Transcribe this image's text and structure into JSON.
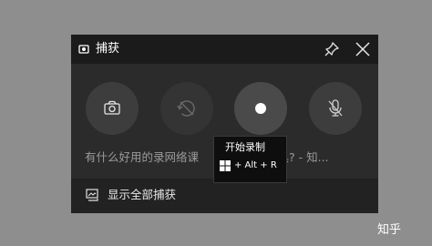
{
  "window": {
    "title": "捕获",
    "icon": "capture-widget-icon",
    "pin_icon": "pin-icon",
    "close_icon": "close-icon"
  },
  "buttons": {
    "screenshot_icon": "camera-icon",
    "record_last_icon": "record-last-30s-icon",
    "record_icon": "record-dot-icon",
    "mic_icon": "microphone-off-icon"
  },
  "status_text": "有什么好用的录网络课",
  "status_text_tail": "工具?  - 知...",
  "tooltip": {
    "title": "开始录制",
    "shortcut": "+ Alt + R",
    "key_icon": "windows-logo-icon"
  },
  "footer": {
    "label": "显示全部捕获",
    "icon": "gallery-icon"
  },
  "watermark": "知乎"
}
